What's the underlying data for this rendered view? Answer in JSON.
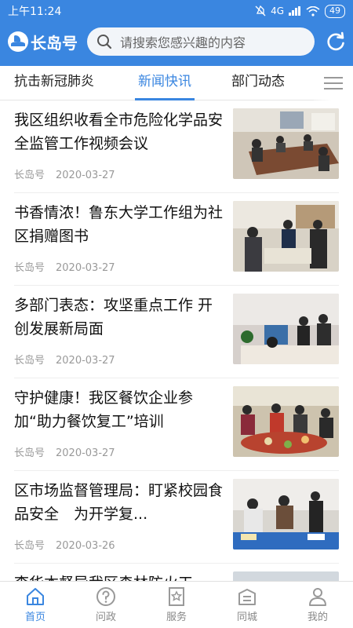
{
  "status_bar": {
    "time": "上午11:24",
    "battery": "49",
    "network": "4G"
  },
  "header": {
    "app_name": "长岛号",
    "search_placeholder": "请搜索您感兴趣的内容"
  },
  "tabs": [
    {
      "label": "抗击新冠肺炎",
      "active": false
    },
    {
      "label": "新闻快讯",
      "active": true
    },
    {
      "label": "部门动态",
      "active": false
    },
    {
      "label": "",
      "active": false
    }
  ],
  "articles": [
    {
      "title": "我区组织收看全市危险化学品安全监管工作视频会议",
      "source": "长岛号",
      "date": "2020-03-27"
    },
    {
      "title": "书香情浓！鲁东大学工作组为社区捐赠图书",
      "source": "长岛号",
      "date": "2020-03-27"
    },
    {
      "title": "多部门表态：攻坚重点工作 开创发展新局面",
      "source": "长岛号",
      "date": "2020-03-27"
    },
    {
      "title": "守护健康！我区餐饮企业参加“助力餐饮复工”培训",
      "source": "长岛号",
      "date": "2020-03-27"
    },
    {
      "title": "区市场监督管理局：盯紧校园食品安全　为开学复...",
      "source": "长岛号",
      "date": "2020-03-26"
    },
    {
      "title": "李华本督导我区森林防火工",
      "source": "",
      "date": ""
    }
  ],
  "bottom_nav": [
    {
      "label": "首页",
      "icon": "home-icon",
      "active": true
    },
    {
      "label": "问政",
      "icon": "question-icon",
      "active": false
    },
    {
      "label": "服务",
      "icon": "service-icon",
      "active": false
    },
    {
      "label": "同城",
      "icon": "city-icon",
      "active": false
    },
    {
      "label": "我的",
      "icon": "profile-icon",
      "active": false
    }
  ],
  "colors": {
    "accent": "#3a86e0",
    "meta_text": "#999999"
  }
}
